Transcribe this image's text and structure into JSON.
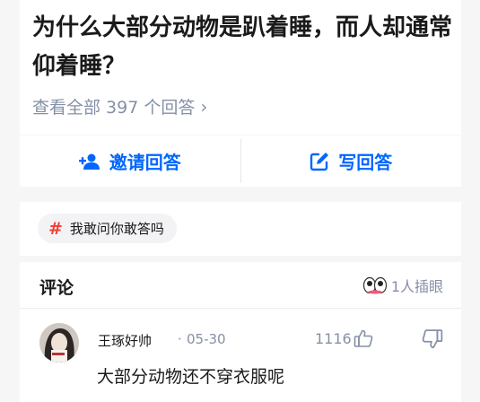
{
  "question": {
    "title": "为什么大部分动物是趴着睡，而人却通常仰着睡？",
    "answer_count_label": "查看全部 397 个回答",
    "chevron": "›"
  },
  "actions": {
    "invite_label": "邀请回答",
    "write_label": "写回答"
  },
  "tag": {
    "symbol": "#",
    "label": "我敢问你敢答吗"
  },
  "comments": {
    "title": "评论",
    "watchers_label": "1人插眼",
    "items": [
      {
        "author": "王琢好帅",
        "separator": "·",
        "date": "05-30",
        "likes": "1116",
        "text": "大部分动物还不穿衣服呢"
      }
    ]
  },
  "colors": {
    "accent": "#0066ff",
    "tag_hash": "#f1403c",
    "muted": "#8590a6"
  },
  "icons": [
    "add-person-icon",
    "edit-icon",
    "hashtag-icon",
    "eyes-icon",
    "thumbs-up-icon",
    "thumbs-down-icon",
    "chevron-right-icon"
  ]
}
